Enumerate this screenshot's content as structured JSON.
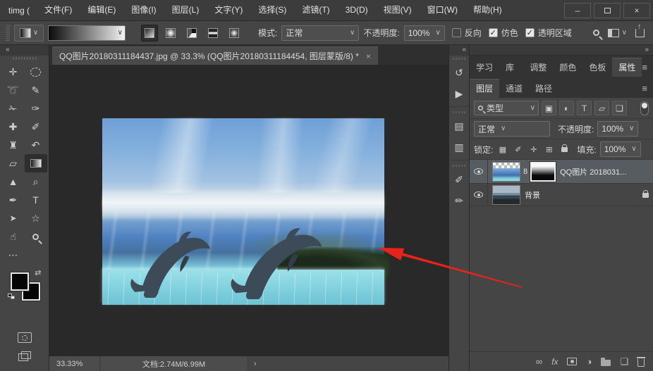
{
  "titlebar": {
    "app_title": "timg (",
    "menus": [
      "文件(F)",
      "编辑(E)",
      "图像(I)",
      "图层(L)",
      "文字(Y)",
      "选择(S)",
      "滤镜(T)",
      "3D(D)",
      "视图(V)",
      "窗口(W)",
      "帮助(H)"
    ],
    "controls": {
      "minimize": "–",
      "close": "×"
    }
  },
  "options_bar": {
    "mode_label": "模式:",
    "mode_value": "正常",
    "opacity_label": "不透明度:",
    "opacity_value": "100%",
    "reverse_label": "反向",
    "dither_label": "仿色",
    "transparency_label": "透明区域",
    "gradient_types": [
      "linear",
      "radial",
      "angle",
      "reflected",
      "diamond"
    ],
    "selected_gradient_type": "linear"
  },
  "document_tab": {
    "title": "QQ图片20180311184437.jpg @ 33.3% (QQ图片20180311184454, 图层蒙版/8) *",
    "close": "×"
  },
  "toolbar": {
    "collapse": "«",
    "tools": [
      {
        "name": "move-tool",
        "glyph": "✛"
      },
      {
        "name": "marquee-tool",
        "glyph": ""
      },
      {
        "name": "lasso-tool",
        "glyph": "➰"
      },
      {
        "name": "quick-selection-tool",
        "glyph": "✎"
      },
      {
        "name": "crop-tool",
        "glyph": "✁"
      },
      {
        "name": "eyedropper-tool",
        "glyph": "✑"
      },
      {
        "name": "spot-healing-tool",
        "glyph": "✚"
      },
      {
        "name": "brush-tool",
        "glyph": "✐"
      },
      {
        "name": "clone-stamp-tool",
        "glyph": "♜"
      },
      {
        "name": "history-brush-tool",
        "glyph": "↶"
      },
      {
        "name": "eraser-tool",
        "glyph": "▱"
      },
      {
        "name": "gradient-tool",
        "glyph": ""
      },
      {
        "name": "blur-tool",
        "glyph": "▲"
      },
      {
        "name": "dodge-tool",
        "glyph": "⌕"
      },
      {
        "name": "pen-tool",
        "glyph": "✒"
      },
      {
        "name": "type-tool",
        "glyph": "T"
      },
      {
        "name": "path-select-tool",
        "glyph": "➤"
      },
      {
        "name": "shape-tool",
        "glyph": "☆"
      },
      {
        "name": "hand-tool",
        "glyph": "☝"
      },
      {
        "name": "zoom-tool",
        "glyph": ""
      },
      {
        "name": "edit-toolbar",
        "glyph": "⋯"
      }
    ],
    "selected_tool": "gradient-tool",
    "swap_glyph": "⇄"
  },
  "dock": {
    "collapse": "«",
    "icons": [
      {
        "name": "history-panel",
        "glyph": "↺"
      },
      {
        "name": "actions-panel",
        "glyph": "▶"
      },
      {
        "name": "character-panel",
        "glyph": "▤"
      },
      {
        "name": "paragraph-panel",
        "glyph": "▥"
      },
      {
        "name": "brush-settings-panel",
        "glyph": "✐"
      },
      {
        "name": "brushes-panel",
        "glyph": "✏"
      }
    ]
  },
  "right_panels": {
    "expand": "»",
    "burger": "≡",
    "tabs_row1": [
      "学习",
      "库",
      "调整",
      "颜色",
      "色板",
      "属性"
    ],
    "active_tab_row1": "属性",
    "layers_tabs": [
      "图层",
      "通道",
      "路径"
    ],
    "active_layers_tab": "图层",
    "filter": {
      "type_label": "类型",
      "icons": [
        {
          "name": "filter-pixel-layers",
          "glyph": "▣"
        },
        {
          "name": "filter-adjustment-layers",
          "glyph": "◐"
        },
        {
          "name": "filter-type-layers",
          "glyph": "T"
        },
        {
          "name": "filter-shape-layers",
          "glyph": "▱"
        },
        {
          "name": "filter-smart-objects",
          "glyph": "❏"
        }
      ]
    },
    "blend_mode": "正常",
    "opacity_label": "不透明度:",
    "opacity_value": "100%",
    "lock_label": "锁定:",
    "lock_icons": [
      {
        "name": "lock-transparent-pixels",
        "glyph": "▦"
      },
      {
        "name": "lock-image-pixels",
        "glyph": "✐"
      },
      {
        "name": "lock-position",
        "glyph": "✛"
      },
      {
        "name": "lock-artboard",
        "glyph": "⊞"
      }
    ],
    "fill_label": "填充:",
    "fill_value": "100%",
    "layers": [
      {
        "name": "QQ图片 2018031...",
        "selected": true,
        "has_mask": true,
        "link": "8"
      },
      {
        "name": "背景",
        "locked": true
      }
    ],
    "bottom_icons": [
      {
        "name": "link-layers",
        "glyph": "∞"
      },
      {
        "name": "layer-style",
        "glyph": "fx"
      },
      {
        "name": "add-layer-mask",
        "glyph": ""
      },
      {
        "name": "new-adjustment-layer",
        "glyph": "◑"
      },
      {
        "name": "new-group",
        "glyph": ""
      },
      {
        "name": "new-layer",
        "glyph": "❏"
      },
      {
        "name": "delete-layer",
        "glyph": ""
      }
    ]
  },
  "status_bar": {
    "zoom_level": "33.33%",
    "doc_size": "文档:2.74M/6.99M",
    "arrow": "›"
  },
  "annotation": {
    "arrow_color": "#e8231a"
  },
  "chev": "∨"
}
